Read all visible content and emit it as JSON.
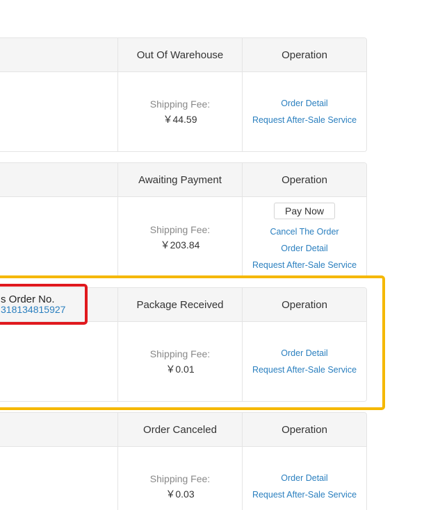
{
  "labels": {
    "operation": "Operation",
    "shipping_fee": "Shipping Fee:",
    "order_detail": "Order Detail",
    "after_sale": "Request After-Sale Service",
    "pay_now": "Pay Now",
    "cancel_order": "Cancel The Order",
    "order_no_label": "s Order No."
  },
  "orders": [
    {
      "status": "Out Of Warehouse",
      "fee": "￥44.59"
    },
    {
      "status": "Awaiting Payment",
      "fee": "￥203.84"
    },
    {
      "status": "Package Received",
      "fee": "￥0.01",
      "order_no": "318134815927"
    },
    {
      "status": "Order Canceled",
      "fee": "￥0.03"
    }
  ],
  "colors": {
    "link": "#2a7fbf",
    "highlight_yellow": "#f5b800",
    "highlight_red": "#e0191e"
  }
}
